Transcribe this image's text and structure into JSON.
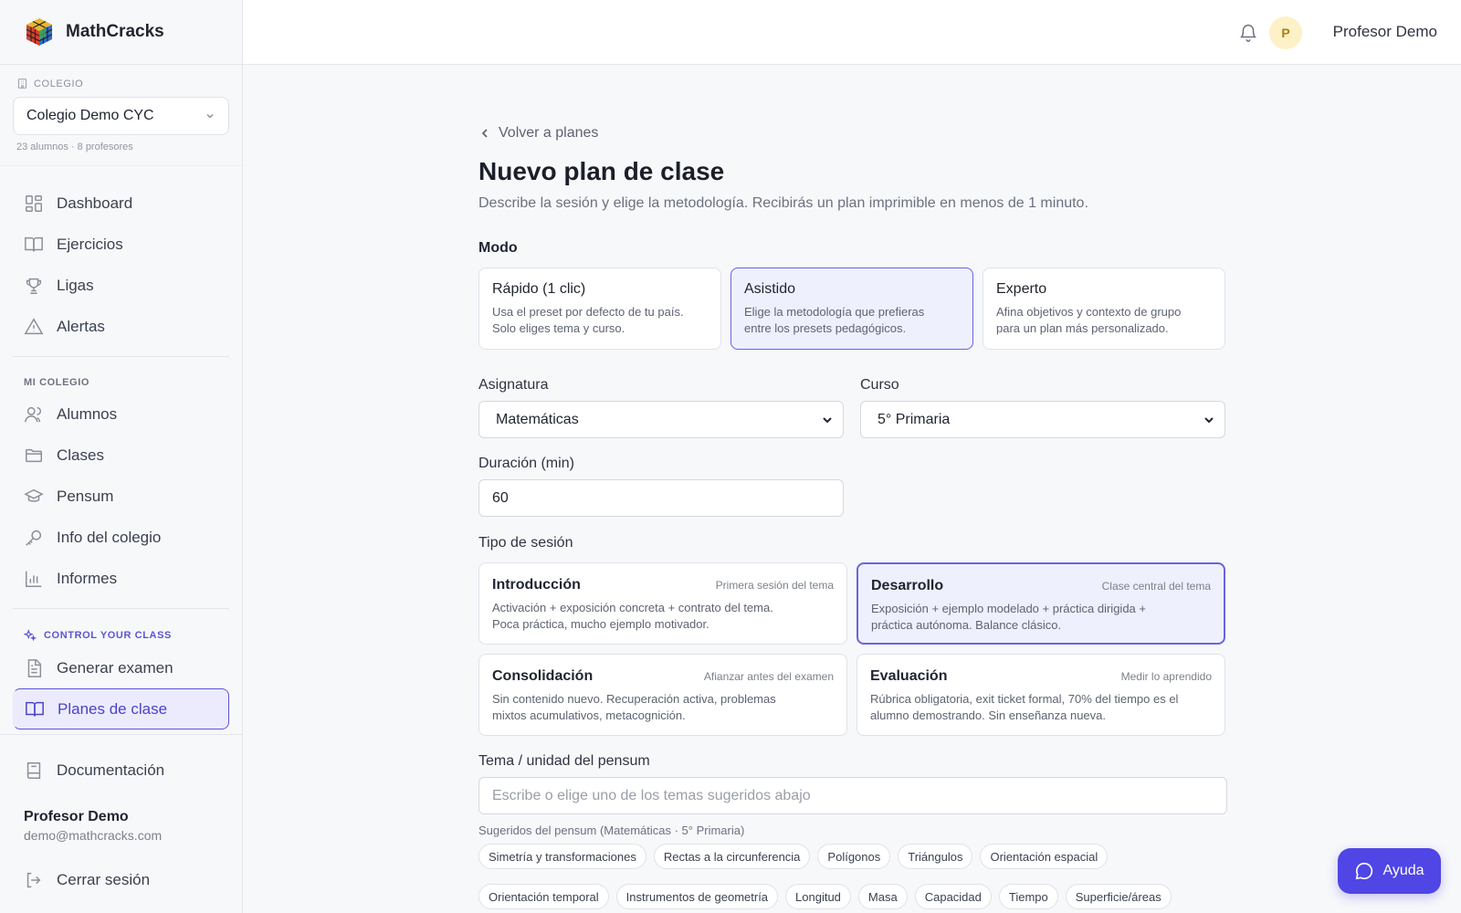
{
  "app": {
    "name": "MathCracks"
  },
  "sidebar": {
    "school_label": "COLEGIO",
    "school_selected": "Colegio Demo CYC",
    "school_meta": "23 alumnos · 8 profesores",
    "main_items": [
      {
        "label": "Dashboard",
        "icon": "grid-icon"
      },
      {
        "label": "Ejercicios",
        "icon": "book-icon"
      },
      {
        "label": "Ligas",
        "icon": "trophy-icon"
      },
      {
        "label": "Alertas",
        "icon": "warning-icon"
      }
    ],
    "school_section_label": "MI COLEGIO",
    "school_items": [
      {
        "label": "Alumnos",
        "icon": "users-icon"
      },
      {
        "label": "Clases",
        "icon": "folder-icon"
      },
      {
        "label": "Pensum",
        "icon": "graduation-cap-icon"
      },
      {
        "label": "Info del colegio",
        "icon": "key-icon"
      },
      {
        "label": "Informes",
        "icon": "bar-chart-icon"
      }
    ],
    "cyc_section_label": "CONTROL YOUR CLASS",
    "cyc_items": [
      {
        "label": "Generar examen",
        "icon": "file-text-icon"
      },
      {
        "label": "Planes de clase",
        "icon": "book-open-icon",
        "active": true
      }
    ],
    "docs_label": "Documentación",
    "user_name": "Profesor Demo",
    "user_email": "demo@mathcracks.com",
    "logout_label": "Cerrar sesión"
  },
  "topbar": {
    "avatar_initial": "P",
    "user_name": "Profesor Demo"
  },
  "main": {
    "back_label": "Volver a planes",
    "title": "Nuevo plan de clase",
    "subtitle": "Describe la sesión y elige la metodología. Recibirás un plan imprimible en menos de 1 minuto.",
    "mode_label": "Modo",
    "modes": [
      {
        "title": "Rápido (1 clic)",
        "line1": "Usa el preset por defecto de tu país.",
        "line2": "Solo eliges tema y curso."
      },
      {
        "title": "Asistido",
        "line1": "Elige la metodología que prefieras",
        "line2": "entre los presets pedagógicos.",
        "selected": true
      },
      {
        "title": "Experto",
        "line1": "Afina objetivos y contexto de grupo",
        "line2": "para un plan más personalizado."
      }
    ],
    "subject_label": "Asignatura",
    "subject_value": "Matemáticas",
    "course_label": "Curso",
    "course_value": "5° Primaria",
    "duration_label": "Duración (min)",
    "duration_value": "60",
    "session_label": "Tipo de sesión",
    "sessions": [
      {
        "title": "Introducción",
        "meta": "Primera sesión del tema",
        "line1": "Activación + exposición concreta + contrato del tema.",
        "line2": "Poca práctica, mucho ejemplo motivador."
      },
      {
        "title": "Desarrollo",
        "meta": "Clase central del tema",
        "line1": "Exposición + ejemplo modelado + práctica dirigida +",
        "line2": "práctica autónoma. Balance clásico.",
        "selected": true
      },
      {
        "title": "Consolidación",
        "meta": "Afianzar antes del examen",
        "line1": "Sin contenido nuevo. Recuperación activa, problemas",
        "line2": "mixtos acumulativos, metacognición."
      },
      {
        "title": "Evaluación",
        "meta": "Medir lo aprendido",
        "line1": "Rúbrica obligatoria, exit ticket formal, 70% del tiempo es el",
        "line2": "alumno demostrando. Sin enseñanza nueva."
      }
    ],
    "topic_label": "Tema / unidad del pensum",
    "topic_placeholder": "Escribe o elige uno de los temas sugeridos abajo",
    "suggest_hint": "Sugeridos del pensum (Matemáticas · 5° Primaria)",
    "chips_row1": [
      "Simetría y transformaciones",
      "Rectas a la circunferencia",
      "Polígonos",
      "Triángulos",
      "Orientación espacial"
    ],
    "chips_row2": [
      "Orientación temporal",
      "Instrumentos de geometría",
      "Longitud",
      "Masa",
      "Capacidad",
      "Tiempo",
      "Superficie/áreas"
    ]
  },
  "help": {
    "label": "Ayuda"
  },
  "colors": {
    "accent": "#4f46e5",
    "selected_bg": "#eef0fd",
    "avatar_bg": "#fdf1c7"
  }
}
